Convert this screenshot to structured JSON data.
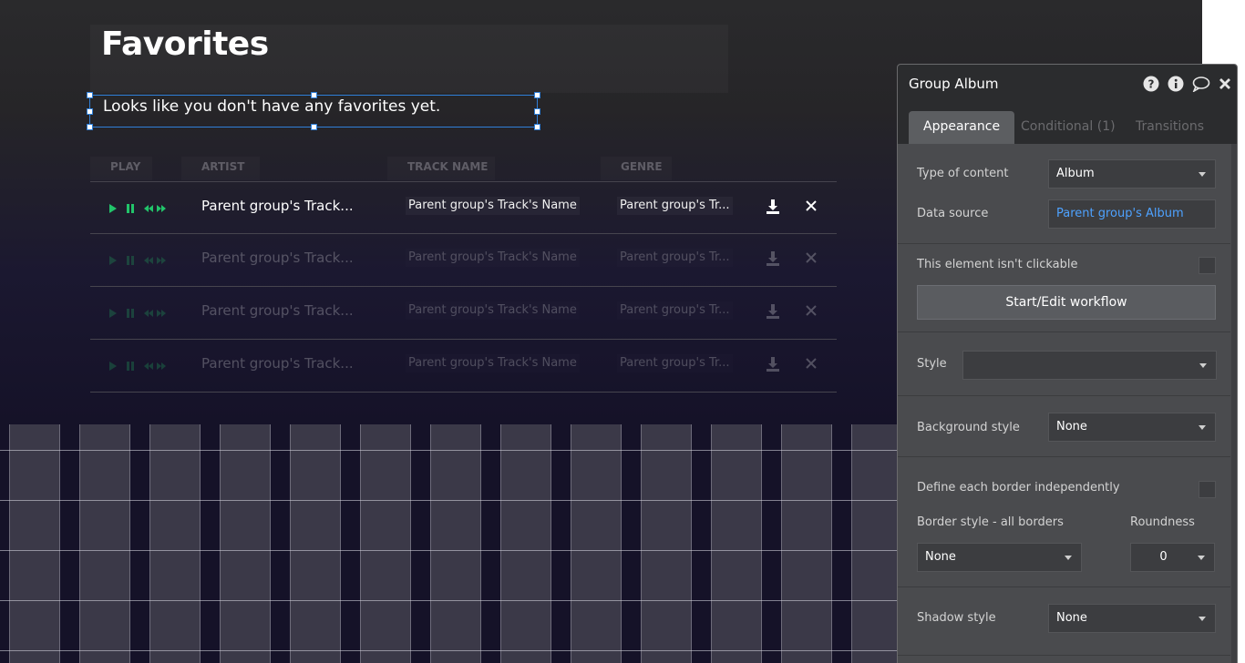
{
  "canvas": {
    "page_title": "Favorites",
    "empty_message": "Looks like you don't have any favorites yet.",
    "table": {
      "headers": [
        "PLAY",
        "ARTIST",
        "TRACK NAME",
        "GENRE"
      ],
      "rows": [
        {
          "artist": "Parent group's Track...",
          "track": "Parent group's Track's Name",
          "genre": "Parent group's Tr...",
          "faded": false
        },
        {
          "artist": "Parent group's Track...",
          "track": "Parent group's Track's Name",
          "genre": "Parent group's Tr...",
          "faded": true
        },
        {
          "artist": "Parent group's Track...",
          "track": "Parent group's Track's Name",
          "genre": "Parent group's Tr...",
          "faded": true
        },
        {
          "artist": "Parent group's Track...",
          "track": "Parent group's Track's Name",
          "genre": "Parent group's Tr...",
          "faded": true
        }
      ],
      "play_controls": [
        "play-icon",
        "pause-icon",
        "rewind-icon",
        "fast-forward-icon"
      ],
      "row_actions": [
        "download-icon",
        "close-icon"
      ],
      "accent_color": "#22c46a"
    }
  },
  "panel": {
    "title": "Group Album",
    "header_icons": [
      "help-icon",
      "info-icon",
      "comment-icon",
      "close-icon"
    ],
    "tabs": [
      "Appearance",
      "Conditional (1)",
      "Transitions"
    ],
    "active_tab": "Appearance",
    "type_of_content": {
      "label": "Type of content",
      "value": "Album"
    },
    "data_source": {
      "label": "Data source",
      "value": "Parent group's Album"
    },
    "not_clickable": {
      "label": "This element isn't clickable",
      "checked": false
    },
    "workflow_button": "Start/Edit workflow",
    "style": {
      "label": "Style",
      "value": ""
    },
    "background_style": {
      "label": "Background style",
      "value": "None"
    },
    "define_borders": {
      "label": "Define each border independently",
      "checked": false
    },
    "border_style": {
      "label": "Border style - all borders",
      "value": "None"
    },
    "roundness": {
      "label": "Roundness",
      "value": "0"
    },
    "shadow_style": {
      "label": "Shadow style",
      "value": "None"
    }
  }
}
